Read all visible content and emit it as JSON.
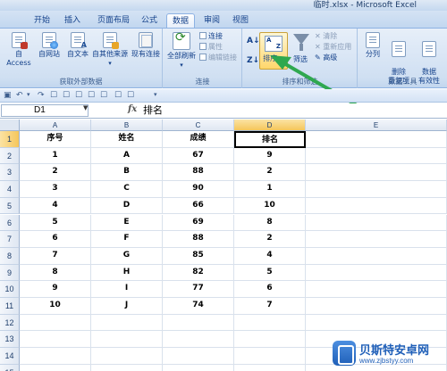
{
  "window": {
    "title": "临时.xlsx - Microsoft Excel"
  },
  "ribbon_tabs": [
    {
      "label": "开始",
      "active": false
    },
    {
      "label": "插入",
      "active": false
    },
    {
      "label": "页面布局",
      "active": false
    },
    {
      "label": "公式",
      "active": false
    },
    {
      "label": "数据",
      "active": true
    },
    {
      "label": "审阅",
      "active": false
    },
    {
      "label": "视图",
      "active": false
    }
  ],
  "groups": {
    "external": {
      "label": "获取外部数据",
      "buttons": [
        "自 Access",
        "自网站",
        "自文本",
        "自其他来源",
        "现有连接"
      ]
    },
    "connections": {
      "label": "连接",
      "refresh_label": "全部刷新",
      "items": [
        "连接",
        "属性",
        "编辑链接"
      ]
    },
    "sort_filter": {
      "label": "排序和筛选",
      "sort_label": "排序...",
      "filter_label": "筛选",
      "items": [
        "清除",
        "重新应用",
        "高级"
      ],
      "sort_az": "A↓",
      "sort_za": "Z↓"
    },
    "tools": {
      "label": "数据工具",
      "buttons": [
        "分列",
        "删除\n重复项",
        "数据\n有效性"
      ]
    }
  },
  "formula_bar": {
    "cell_ref": "D1",
    "fx": "fx",
    "value": "排名"
  },
  "sheet": {
    "columns": [
      "A",
      "B",
      "C",
      "D",
      "E"
    ],
    "selected_column": "D",
    "selected_row": "1",
    "rows": [
      {
        "num": "1",
        "cells": [
          "序号",
          "姓名",
          "成绩",
          "排名",
          ""
        ]
      },
      {
        "num": "2",
        "cells": [
          "1",
          "A",
          "67",
          "9",
          ""
        ]
      },
      {
        "num": "3",
        "cells": [
          "2",
          "B",
          "88",
          "2",
          ""
        ]
      },
      {
        "num": "4",
        "cells": [
          "3",
          "C",
          "90",
          "1",
          ""
        ]
      },
      {
        "num": "5",
        "cells": [
          "4",
          "D",
          "66",
          "10",
          ""
        ]
      },
      {
        "num": "6",
        "cells": [
          "5",
          "E",
          "69",
          "8",
          ""
        ]
      },
      {
        "num": "7",
        "cells": [
          "6",
          "F",
          "88",
          "2",
          ""
        ]
      },
      {
        "num": "8",
        "cells": [
          "7",
          "G",
          "85",
          "4",
          ""
        ]
      },
      {
        "num": "9",
        "cells": [
          "8",
          "H",
          "82",
          "5",
          ""
        ]
      },
      {
        "num": "10",
        "cells": [
          "9",
          "I",
          "77",
          "6",
          ""
        ]
      },
      {
        "num": "11",
        "cells": [
          "10",
          "J",
          "74",
          "7",
          ""
        ]
      },
      {
        "num": "12",
        "cells": [
          "",
          "",
          "",
          "",
          ""
        ]
      },
      {
        "num": "13",
        "cells": [
          "",
          "",
          "",
          "",
          ""
        ]
      },
      {
        "num": "14",
        "cells": [
          "",
          "",
          "",
          "",
          ""
        ]
      },
      {
        "num": "15",
        "cells": [
          "",
          "",
          "",
          "",
          ""
        ]
      }
    ]
  },
  "watermark": {
    "name": "贝斯特安卓网",
    "url": "www.zjbstyy.com"
  },
  "colors": {
    "arrow": "#2fa84f",
    "selection": "#f5c65a"
  }
}
